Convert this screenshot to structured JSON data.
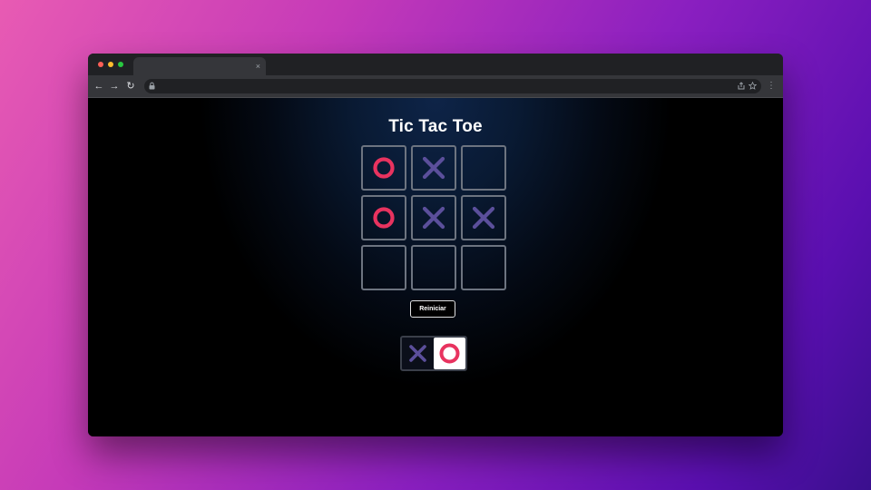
{
  "browser": {
    "tab_close_glyph": "×",
    "nav": {
      "back_glyph": "←",
      "forward_glyph": "→",
      "reload_glyph": "↻"
    },
    "omnibox": {
      "lock_glyph": "🔒",
      "share_glyph": "⇪",
      "star_glyph": "☆"
    },
    "menu_glyph": "⋮"
  },
  "game": {
    "title": "Tic Tac Toe",
    "board": [
      [
        "O",
        "X",
        ""
      ],
      [
        "O",
        "X",
        "X"
      ],
      [
        "",
        "",
        ""
      ]
    ],
    "restart_label": "Reiniciar",
    "turn": {
      "options": [
        "X",
        "O"
      ],
      "active": "O"
    },
    "colors": {
      "x_color": "#5b4f9b",
      "o_color": "#e8335f",
      "cell_border": "#6d7480"
    }
  }
}
